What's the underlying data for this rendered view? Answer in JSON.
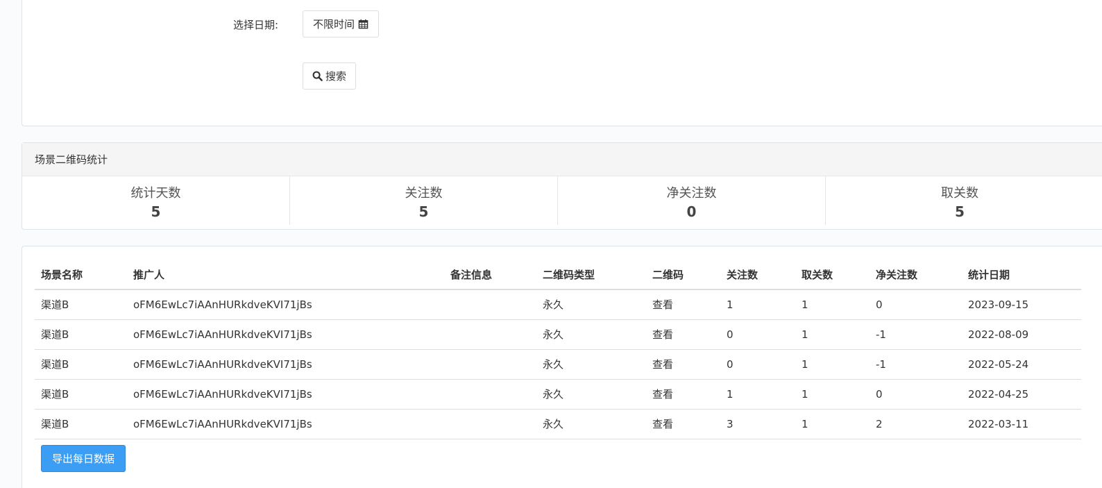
{
  "filter": {
    "date_label": "选择日期:",
    "date_value": "不限时间",
    "search_label": "搜索"
  },
  "stats": {
    "heading": "场景二维码统计",
    "items": [
      {
        "label": "统计天数",
        "value": "5"
      },
      {
        "label": "关注数",
        "value": "5"
      },
      {
        "label": "净关注数",
        "value": "0"
      },
      {
        "label": "取关数",
        "value": "5"
      }
    ]
  },
  "table": {
    "headers": [
      "场景名称",
      "推广人",
      "备注信息",
      "二维码类型",
      "二维码",
      "关注数",
      "取关数",
      "净关注数",
      "统计日期"
    ],
    "rows": [
      [
        "渠道B",
        "oFM6EwLc7iAAnHURkdveKVI71jBs",
        "",
        "永久",
        "查看",
        "1",
        "1",
        "0",
        "2023-09-15"
      ],
      [
        "渠道B",
        "oFM6EwLc7iAAnHURkdveKVI71jBs",
        "",
        "永久",
        "查看",
        "0",
        "1",
        "-1",
        "2022-08-09"
      ],
      [
        "渠道B",
        "oFM6EwLc7iAAnHURkdveKVI71jBs",
        "",
        "永久",
        "查看",
        "0",
        "1",
        "-1",
        "2022-05-24"
      ],
      [
        "渠道B",
        "oFM6EwLc7iAAnHURkdveKVI71jBs",
        "",
        "永久",
        "查看",
        "1",
        "1",
        "0",
        "2022-04-25"
      ],
      [
        "渠道B",
        "oFM6EwLc7iAAnHURkdveKVI71jBs",
        "",
        "永久",
        "查看",
        "3",
        "1",
        "2",
        "2022-03-11"
      ]
    ]
  },
  "export_label": "导出每日数据"
}
